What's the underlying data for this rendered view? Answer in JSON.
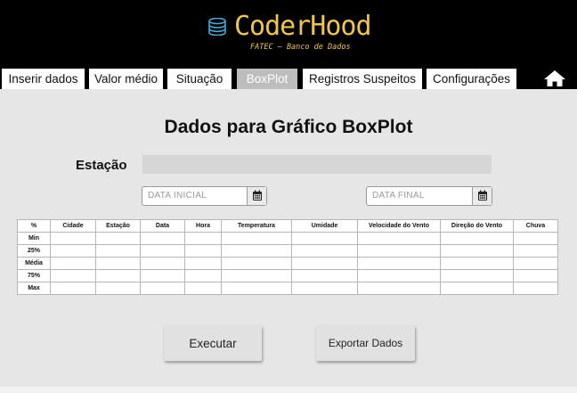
{
  "brand": {
    "title": "CoderHood",
    "subtitle": "FATEC – Banco de Dados",
    "accent": "#f0c64a"
  },
  "tabs": [
    {
      "label": "Inserir dados",
      "active": false
    },
    {
      "label": "Valor médio",
      "active": false
    },
    {
      "label": "Situação",
      "active": false
    },
    {
      "label": "BoxPlot",
      "active": true
    },
    {
      "label": "Registros Suspeitos",
      "active": false
    },
    {
      "label": "Configurações",
      "active": false
    }
  ],
  "home_icon": "home-icon",
  "main": {
    "title": "Dados para Gráfico BoxPlot",
    "estacao_label": "Estação",
    "estacao_value": "",
    "date_start_placeholder": "DATA INICIAL",
    "date_end_placeholder": "DATA FINAL",
    "calendar_icon": "calendar-icon"
  },
  "table": {
    "headers": [
      "%",
      "Cidade",
      "Estação",
      "Data",
      "Hora",
      "Temperatura",
      "Umidade",
      "Velocidade do Vento",
      "Direção do Vento",
      "Chuva"
    ],
    "rows": [
      "Min",
      "25%",
      "Média",
      "75%",
      "Max"
    ]
  },
  "buttons": {
    "execute": "Executar",
    "export": "Exportar Dados"
  }
}
